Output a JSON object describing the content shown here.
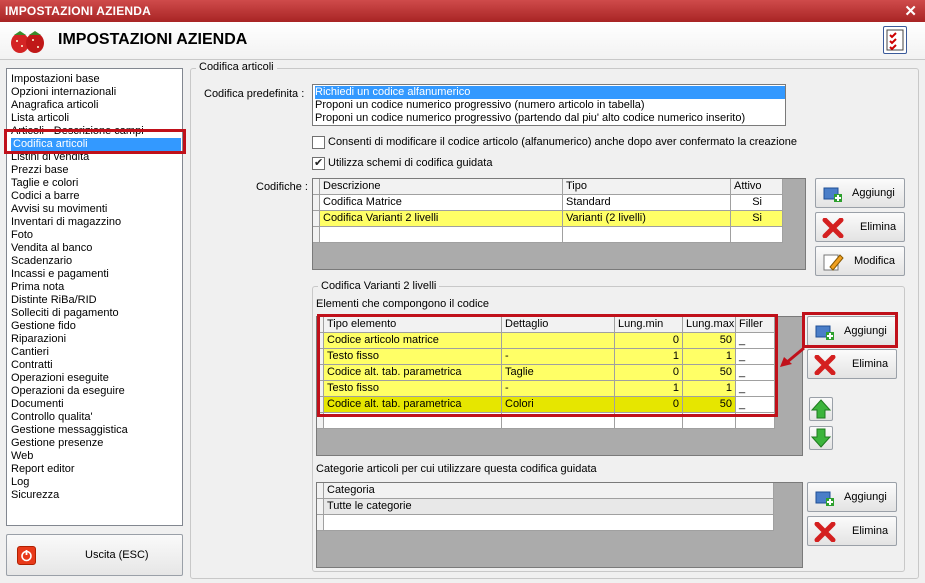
{
  "window": {
    "title": "IMPOSTAZIONI AZIENDA",
    "header_title": "IMPOSTAZIONI AZIENDA",
    "close_glyph": "✕"
  },
  "icons": {
    "logo": "strawberry-logo-icon",
    "checklist": "checklist-icon",
    "exit": "power-icon",
    "add": "add-item-icon",
    "delete": "red-x-icon",
    "edit": "edit-pencil-icon",
    "up": "green-arrow-up-icon",
    "down": "green-arrow-down-icon"
  },
  "colors": {
    "title_bar": "#b83232",
    "selection": "#3399ff",
    "highlight_row": "#ffff66",
    "callout": "#c0101a"
  },
  "nav": {
    "items": [
      "Impostazioni base",
      "Opzioni internazionali",
      "Anagrafica articoli",
      "Lista articoli",
      "Articoli - Descrizione campi",
      "Codifica articoli",
      "Listini di vendita",
      "Prezzi base",
      "Taglie e colori",
      "Codici a barre",
      "Avvisi su movimenti",
      "Inventari di magazzino",
      "Foto",
      "Vendita al banco",
      "Scadenzario",
      "Incassi e pagamenti",
      "Prima nota",
      "Distinte RiBa/RID",
      "Solleciti di pagamento",
      "Gestione fido",
      "Riparazioni",
      "Cantieri",
      "Contratti",
      "Operazioni eseguite",
      "Operazioni da eseguire",
      "Documenti",
      "Controllo qualita'",
      "Gestione messaggistica",
      "Gestione presenze",
      "Web",
      "Report editor",
      "Log",
      "Sicurezza"
    ],
    "selected_index": 5,
    "exit_label": "Uscita (ESC)"
  },
  "main": {
    "group_title": "Codifica articoli",
    "predef_label": "Codifica predefinita :",
    "predef_options": [
      "Richiedi un codice alfanumerico",
      "Proponi un codice numerico progressivo (numero articolo in tabella)",
      "Proponi un codice numerico progressivo (partendo dal piu' alto codice numerico inserito)"
    ],
    "predef_selected": 0,
    "check_modify_label": "Consenti di modificare il codice articolo (alfanumerico) anche dopo aver confermato la creazione",
    "check_modify": false,
    "check_schemes_label": "Utilizza schemi di codifica guidata",
    "check_schemes": true,
    "codifiche_label": "Codifiche :",
    "codifiche_headers": [
      "Descrizione",
      "Tipo",
      "Attivo"
    ],
    "codifiche_rows": [
      {
        "desc": "Codifica Matrice",
        "tipo": "Standard",
        "attivo": "Si"
      },
      {
        "desc": "Codifica Varianti 2 livelli",
        "tipo": "Varianti (2 livelli)",
        "attivo": "Si"
      }
    ],
    "btn_add": "Aggiungi",
    "btn_delete": "Elimina",
    "btn_edit": "Modifica",
    "variant_group_title": "Codifica Varianti 2 livelli",
    "elements_label": "Elementi che compongono il codice",
    "elements_headers": [
      "Tipo elemento",
      "Dettaglio",
      "Lung.min",
      "Lung.max",
      "Filler"
    ],
    "elements_rows": [
      {
        "tipo": "Codice articolo matrice",
        "dettaglio": "",
        "min": "0",
        "max": "50",
        "filler": "_"
      },
      {
        "tipo": "Testo fisso",
        "dettaglio": "-",
        "min": "1",
        "max": "1",
        "filler": "_"
      },
      {
        "tipo": "Codice alt. tab. parametrica",
        "dettaglio": "Taglie",
        "min": "0",
        "max": "50",
        "filler": "_"
      },
      {
        "tipo": "Testo fisso",
        "dettaglio": "-",
        "min": "1",
        "max": "1",
        "filler": "_"
      },
      {
        "tipo": "Codice alt. tab. parametrica",
        "dettaglio": "Colori",
        "min": "0",
        "max": "50",
        "filler": "_"
      }
    ],
    "categories_label": "Categorie articoli per cui utilizzare questa codifica guidata",
    "categories_header": "Categoria",
    "categories_rows": [
      "Tutte le categorie"
    ]
  }
}
